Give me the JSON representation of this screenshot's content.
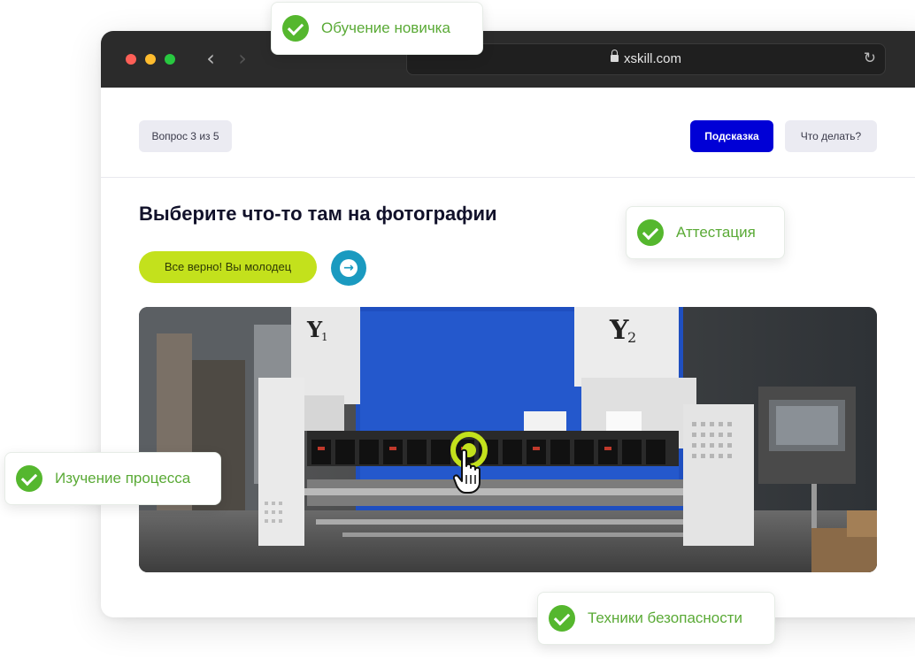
{
  "browser": {
    "url": "xskill.com"
  },
  "toolbar": {
    "question_counter": "Вопрос 3 из 5",
    "hint_button": "Подсказка",
    "what_to_do_button": "Что делать?"
  },
  "task": {
    "title": "Выберите что-то там на фотографии",
    "feedback": "Все верно! Вы молодец"
  },
  "photo": {
    "labels": [
      "Y1",
      "Y2"
    ]
  },
  "badges": [
    {
      "label": "Обучение новичка"
    },
    {
      "label": "Аттестация"
    },
    {
      "label": "Изучение процесса"
    },
    {
      "label": "Техники безопасности"
    }
  ],
  "colors": {
    "accent_blue": "#0000d6",
    "success_lime": "#c3e11c",
    "badge_green": "#55b72e",
    "next_teal": "#1a9ac0"
  },
  "icons": {
    "check": "check-circle-icon",
    "next": "arrow-right-circle-icon",
    "pointer": "hand-pointer-icon"
  }
}
